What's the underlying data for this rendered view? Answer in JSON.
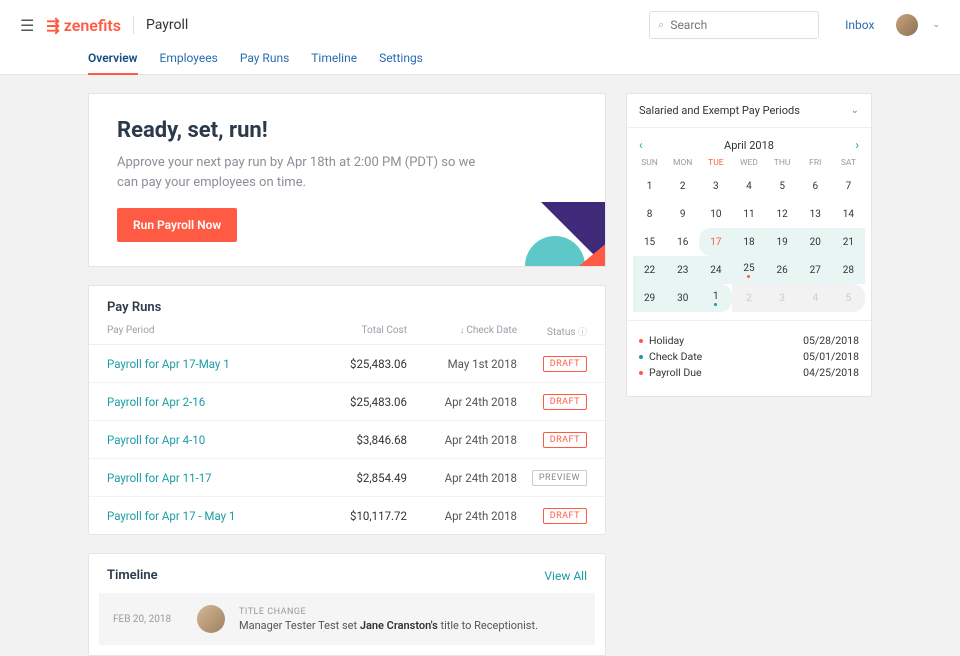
{
  "header": {
    "brand": "zenefits",
    "app_title": "Payroll",
    "search_placeholder": "Search",
    "inbox": "Inbox"
  },
  "tabs": [
    {
      "label": "Overview",
      "active": true
    },
    {
      "label": "Employees",
      "active": false
    },
    {
      "label": "Pay Runs",
      "active": false
    },
    {
      "label": "Timeline",
      "active": false
    },
    {
      "label": "Settings",
      "active": false
    }
  ],
  "hero": {
    "title": "Ready, set, run!",
    "subtitle": "Approve your next pay run by Apr 18th at 2:00 PM (PDT) so we can pay your employees on time.",
    "cta": "Run Payroll Now"
  },
  "payruns": {
    "title": "Pay Runs",
    "cols": {
      "period": "Pay Period",
      "cost": "Total Cost",
      "date": "Check Date",
      "status": "Status"
    },
    "rows": [
      {
        "period": "Payroll for Apr 17-May 1",
        "cost": "$25,483.06",
        "date": "May 1st 2018",
        "status": "DRAFT",
        "style": "draft"
      },
      {
        "period": "Payroll for Apr 2-16",
        "cost": "$25,483.06",
        "date": "Apr 24th 2018",
        "status": "DRAFT",
        "style": "draft"
      },
      {
        "period": "Payroll for Apr 4-10",
        "cost": "$3,846.68",
        "date": "Apr 24th 2018",
        "status": "DRAFT",
        "style": "draft"
      },
      {
        "period": "Payroll for Apr 11-17",
        "cost": "$2,854.49",
        "date": "Apr 24th 2018",
        "status": "PREVIEW",
        "style": "preview"
      },
      {
        "period": "Payroll for Apr 17 - May 1",
        "cost": "$10,117.72",
        "date": "Apr 24th 2018",
        "status": "DRAFT",
        "style": "draft"
      }
    ]
  },
  "timeline": {
    "title": "Timeline",
    "view_all": "View All",
    "entries": [
      {
        "date": "FEB 20, 2018",
        "label": "TITLE CHANGE",
        "prefix": "Manager Tester Test set ",
        "bold": "Jane Cranston's",
        "suffix": " title to Receptionist."
      }
    ]
  },
  "calendar": {
    "widget_title": "Salaried and Exempt Pay Periods",
    "month": "April 2018",
    "weekdays": [
      "SUN",
      "MON",
      "TUE",
      "WED",
      "THU",
      "FRI",
      "SAT"
    ],
    "today_index": 2,
    "days": [
      {
        "n": "1"
      },
      {
        "n": "2"
      },
      {
        "n": "3"
      },
      {
        "n": "4"
      },
      {
        "n": "5"
      },
      {
        "n": "6"
      },
      {
        "n": "7"
      },
      {
        "n": "8"
      },
      {
        "n": "9"
      },
      {
        "n": "10"
      },
      {
        "n": "11"
      },
      {
        "n": "12"
      },
      {
        "n": "13"
      },
      {
        "n": "14"
      },
      {
        "n": "15"
      },
      {
        "n": "16"
      },
      {
        "n": "17",
        "hl": "hlpill-l",
        "red": true
      },
      {
        "n": "18",
        "hl": "hl"
      },
      {
        "n": "19",
        "hl": "hl"
      },
      {
        "n": "20",
        "hl": "hl"
      },
      {
        "n": "21",
        "hl": "hl"
      },
      {
        "n": "22",
        "hl": "hl"
      },
      {
        "n": "23",
        "hl": "hl"
      },
      {
        "n": "24",
        "hl": "hl"
      },
      {
        "n": "25",
        "hl": "hl",
        "dot": "red"
      },
      {
        "n": "26",
        "hl": "hl"
      },
      {
        "n": "27",
        "hl": "hl"
      },
      {
        "n": "28",
        "hl": "hl"
      },
      {
        "n": "29",
        "hl": "hl"
      },
      {
        "n": "30",
        "hl": "hl"
      },
      {
        "n": "1",
        "hl": "hlpill-r",
        "dot": "blue"
      },
      {
        "n": "2",
        "muted": true,
        "hl": "hldim"
      },
      {
        "n": "3",
        "muted": true,
        "hl": "hldim"
      },
      {
        "n": "4",
        "muted": true,
        "hl": "hldim"
      },
      {
        "n": "5",
        "muted": true,
        "hl": "hlpill-r2"
      }
    ],
    "legend": [
      {
        "color": "red",
        "label": "Holiday",
        "date": "05/28/2018"
      },
      {
        "color": "blue",
        "label": "Check Date",
        "date": "05/01/2018"
      },
      {
        "color": "red",
        "label": "Payroll Due",
        "date": "04/25/2018"
      }
    ]
  }
}
